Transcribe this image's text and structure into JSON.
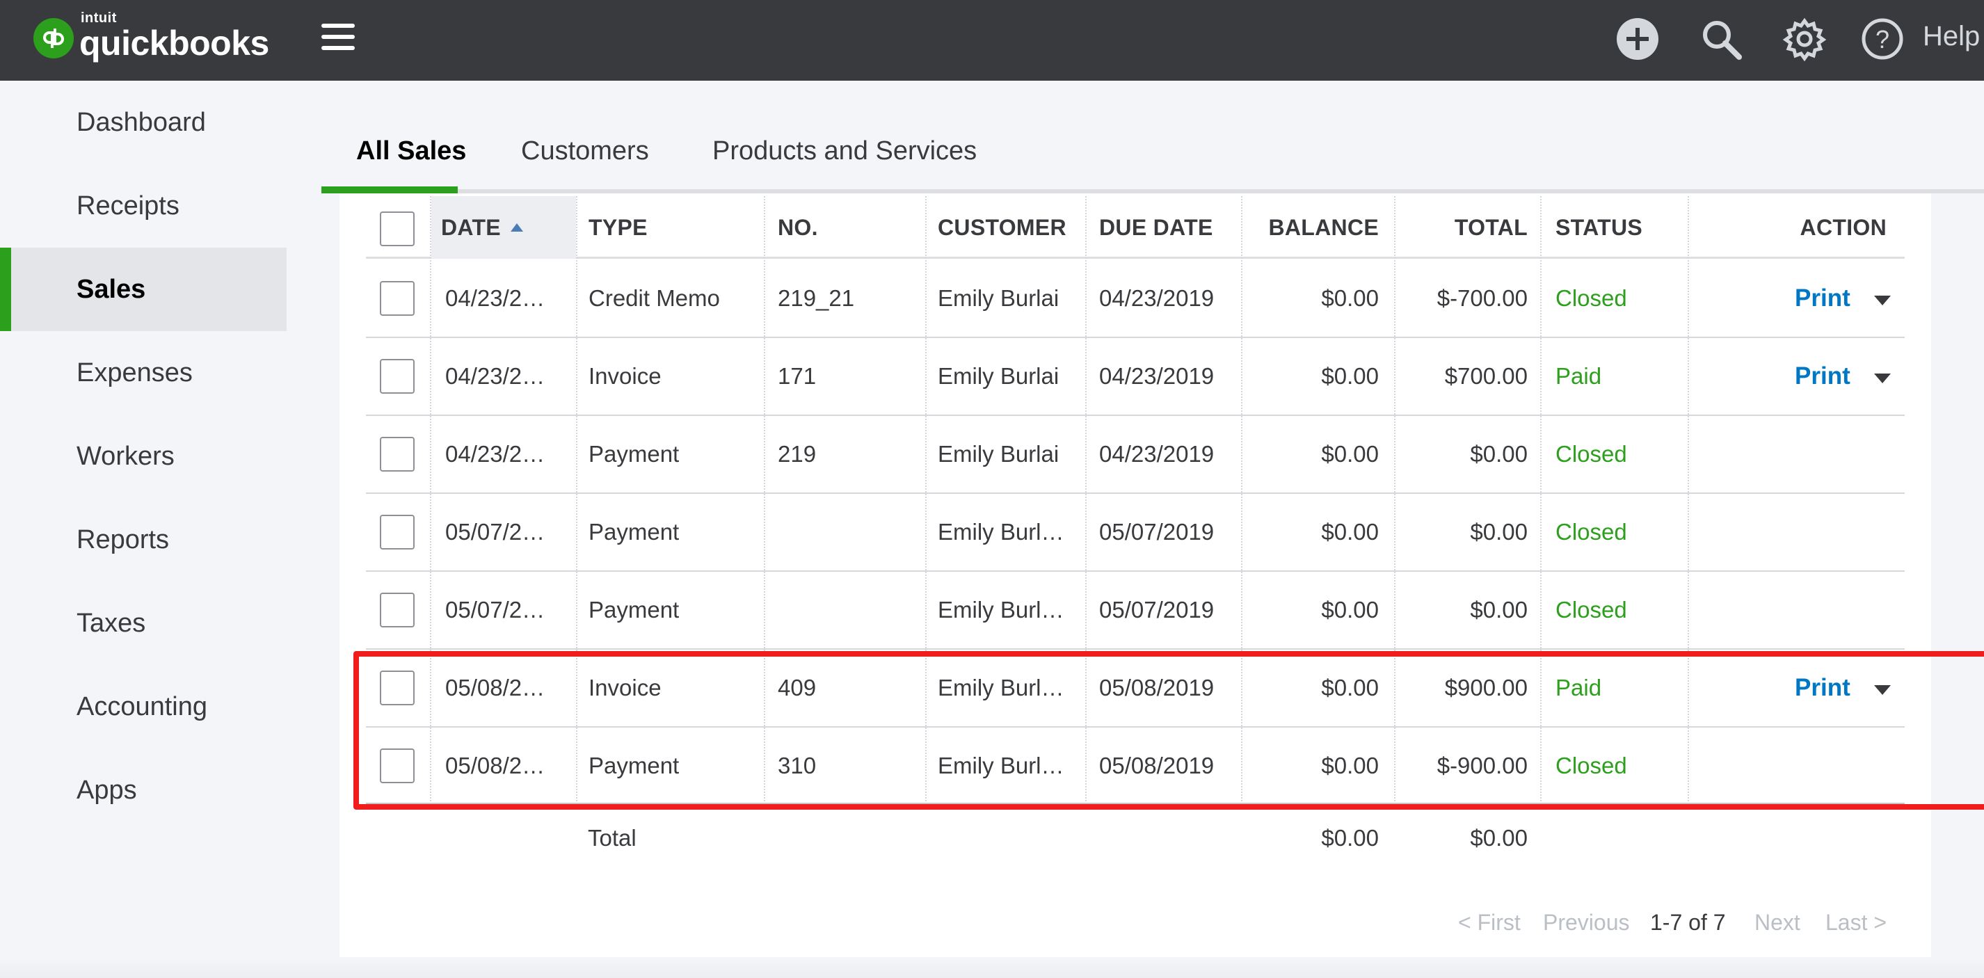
{
  "app": {
    "logo_small": "intuit",
    "logo_name": "quickbooks",
    "brand_color": "#2ca01c"
  },
  "header": {
    "icons": [
      "plus-circle-icon",
      "search-icon",
      "gear-icon",
      "help-circle-icon"
    ],
    "help_label": "Help"
  },
  "sidebar": {
    "items": [
      {
        "label": "Dashboard"
      },
      {
        "label": "Receipts"
      },
      {
        "label": "Sales",
        "active": true
      },
      {
        "label": "Expenses"
      },
      {
        "label": "Workers"
      },
      {
        "label": "Reports"
      },
      {
        "label": "Taxes"
      },
      {
        "label": "Accounting"
      },
      {
        "label": "Apps"
      }
    ]
  },
  "tabs": [
    {
      "label": "All Sales",
      "active": true
    },
    {
      "label": "Customers"
    },
    {
      "label": "Products and Services"
    }
  ],
  "table": {
    "columns": [
      "DATE",
      "TYPE",
      "NO.",
      "CUSTOMER",
      "DUE DATE",
      "BALANCE",
      "TOTAL",
      "STATUS",
      "ACTION"
    ],
    "rows": [
      {
        "date": "04/23/2…",
        "type": "Credit Memo",
        "no": "219_21",
        "customer": "Emily Burlai",
        "due": "04/23/2019",
        "balance": "$0.00",
        "total": "$-700.00",
        "status": "Closed",
        "action": "Print"
      },
      {
        "date": "04/23/2…",
        "type": "Invoice",
        "no": "171",
        "customer": "Emily Burlai",
        "due": "04/23/2019",
        "balance": "$0.00",
        "total": "$700.00",
        "status": "Paid",
        "action": "Print"
      },
      {
        "date": "04/23/2…",
        "type": "Payment",
        "no": "219",
        "customer": "Emily Burlai",
        "due": "04/23/2019",
        "balance": "$0.00",
        "total": "$0.00",
        "status": "Closed",
        "action": ""
      },
      {
        "date": "05/07/2…",
        "type": "Payment",
        "no": "",
        "customer": "Emily Burl…",
        "due": "05/07/2019",
        "balance": "$0.00",
        "total": "$0.00",
        "status": "Closed",
        "action": ""
      },
      {
        "date": "05/07/2…",
        "type": "Payment",
        "no": "",
        "customer": "Emily Burl…",
        "due": "05/07/2019",
        "balance": "$0.00",
        "total": "$0.00",
        "status": "Closed",
        "action": ""
      },
      {
        "date": "05/08/2…",
        "type": "Invoice",
        "no": "409",
        "customer": "Emily Burl…",
        "due": "05/08/2019",
        "balance": "$0.00",
        "total": "$900.00",
        "status": "Paid",
        "action": "Print"
      },
      {
        "date": "05/08/2…",
        "type": "Payment",
        "no": "310",
        "customer": "Emily Burl…",
        "due": "05/08/2019",
        "balance": "$0.00",
        "total": "$-900.00",
        "status": "Closed",
        "action": ""
      }
    ],
    "totals": {
      "label": "Total",
      "balance": "$0.00",
      "total": "$0.00"
    }
  },
  "pagination": {
    "first": "< First",
    "previous": "Previous",
    "range": "1-7 of 7",
    "next": "Next",
    "last": "Last >"
  },
  "colors": {
    "status_green": "#2ca01c",
    "link_blue": "#0077c5",
    "highlight_red": "#f11c1c",
    "topbar": "#393a3d"
  }
}
